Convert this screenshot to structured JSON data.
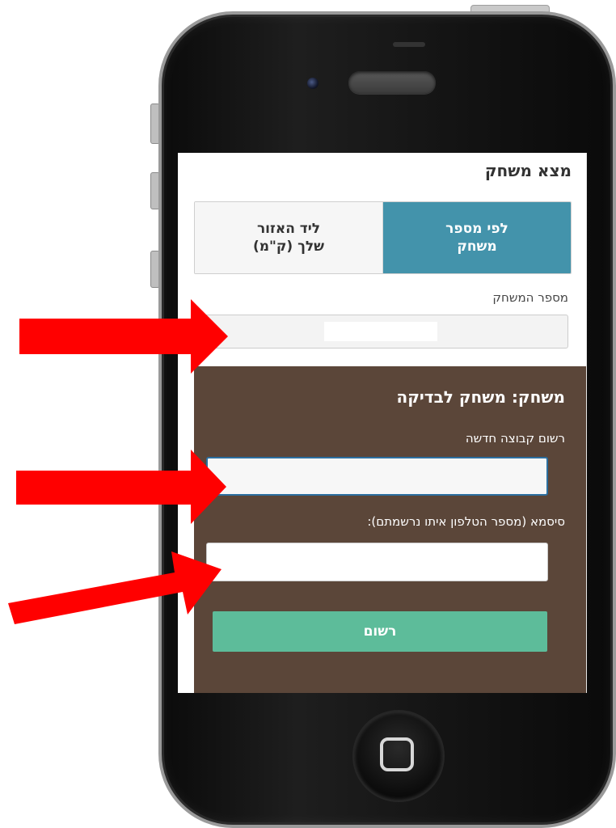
{
  "screen": {
    "page_title": "מצא משחק",
    "tabs": [
      {
        "label": "לפי מספר\nמשחק",
        "active": true
      },
      {
        "label": "ליד האזור\nשלך (ק\"מ)",
        "active": false
      }
    ],
    "game_number": {
      "label": "מספר המשחק",
      "value": ""
    },
    "game_panel": {
      "title": "משחק: משחק לבדיקה",
      "group_label": "רשום קבוצה חדשה",
      "group_value": "",
      "password_label": "סיסמא (מספר הטלפון איתו נרשמתם):",
      "password_value": "",
      "register_button": "רשום"
    }
  },
  "colors": {
    "tab_active": "#4393ab",
    "panel_bg": "#5b4639",
    "button_bg": "#5dbc9a",
    "arrow": "#ff0000"
  },
  "annotations": {
    "arrow_icon": "red-arrow",
    "arrow_count": 3
  }
}
